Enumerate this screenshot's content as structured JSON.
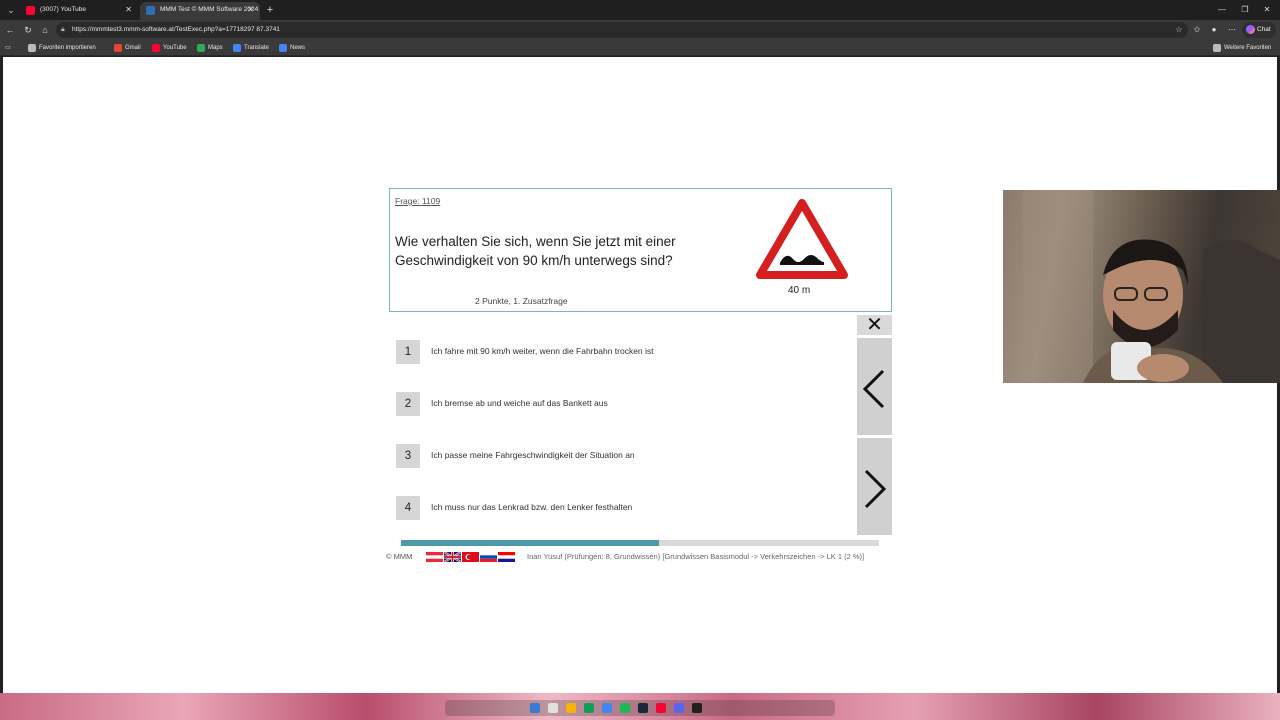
{
  "browser": {
    "tabs": [
      {
        "title": "(3007) YouTube",
        "active": false,
        "favicon_color": "#ff0033"
      },
      {
        "title": "MMM Test © MMM Software 2024",
        "active": true,
        "favicon_color": "#2f6fb7"
      }
    ],
    "url": "https://mmmtest3.mmm-software.at/TestExec.php?a=17718297 87.3741",
    "chat_label": "Chat",
    "bookmarks": [
      {
        "label": "Favoriten importieren",
        "color": "#bbbbbb"
      },
      {
        "label": "Gmail",
        "color": "#ea4335"
      },
      {
        "label": "YouTube",
        "color": "#ff0033"
      },
      {
        "label": "Maps",
        "color": "#34a853"
      },
      {
        "label": "Translate",
        "color": "#4285f4"
      },
      {
        "label": "News",
        "color": "#4285f4"
      }
    ],
    "other_favorites": "Weitere Favoriten"
  },
  "quiz": {
    "question_number": "Frage: 1109",
    "question_text": "Wie verhalten Sie sich, wenn Sie jetzt mit einer Geschwindigkeit von 90 km/h unterwegs sind?",
    "points": "2 Punkte, 1. Zusatzfrage",
    "sign_icon": "bumpy-road-warning-sign",
    "sign_distance": "40 m",
    "answers": [
      {
        "number": "1",
        "text": "Ich fahre mit 90 km/h weiter, wenn die Fahrbahn trocken ist"
      },
      {
        "number": "2",
        "text": "Ich bremse ab und weiche auf das Bankett aus"
      },
      {
        "number": "3",
        "text": "Ich passe meine Fahrgeschwindigkeit der Situation an"
      },
      {
        "number": "4",
        "text": "Ich muss nur das Lenkrad bzw. den Lenker festhalten"
      }
    ],
    "progress_fraction": 0.54,
    "accent_color": "#4e9aa8"
  },
  "footer": {
    "copyright": "© MMM",
    "flags": [
      "austria",
      "uk",
      "turkey",
      "slovenia",
      "croatia"
    ],
    "info": "Inan Yusuf (Prüfungen: 8, Grundwissen) [Grundwissen Basismodul -> Verkehrszeichen -> LK 1 (2 %)]"
  }
}
